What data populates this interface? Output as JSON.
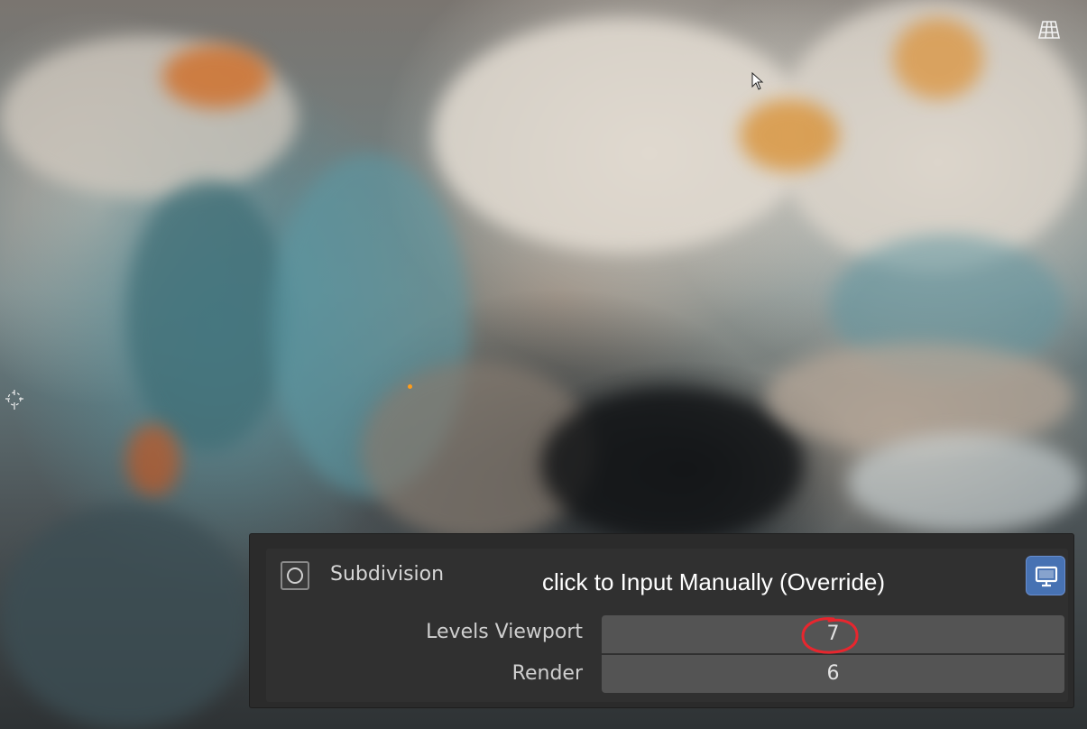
{
  "viewport": {
    "grid_icon": "grid-perspective-icon",
    "cursor_icon": "arrow-cursor-icon"
  },
  "modifier": {
    "title": "Subdivision",
    "icon": "subdivision-ring-icon",
    "realtime_icon": "monitor-icon",
    "accent_color": "#4772b3",
    "annotation": "click to Input Manually (Override)",
    "fields": [
      {
        "label": "Levels Viewport",
        "value": "7"
      },
      {
        "label": "Render",
        "value": "6"
      }
    ],
    "highlight_color": "#e8262e"
  }
}
